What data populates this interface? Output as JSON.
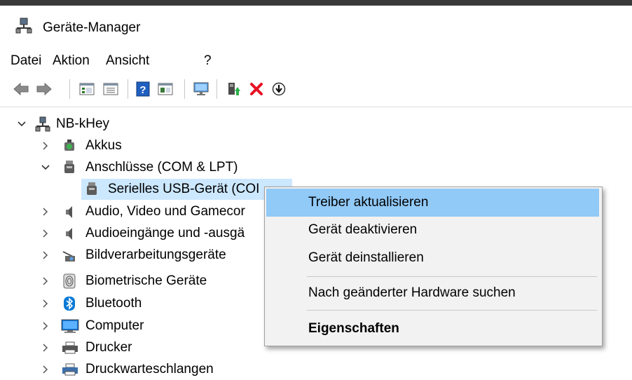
{
  "window": {
    "title": "Geräte-Manager"
  },
  "menu": [
    "Datei",
    "Aktion",
    "Ansicht",
    "?"
  ],
  "toolbar": [
    "back-icon",
    "forward-icon",
    "tree-view-icon",
    "properties-icon",
    "help-icon",
    "action-view-icon",
    "monitor-icon",
    "update-driver-icon",
    "uninstall-icon",
    "enable-icon"
  ],
  "tree": {
    "root": "NB-kHey",
    "items": [
      {
        "label": "Akkus",
        "expanded": false,
        "icon": "battery-icon"
      },
      {
        "label": "Anschlüsse (COM & LPT)",
        "expanded": true,
        "icon": "port-icon"
      },
      {
        "label": "Serielles USB-Gerät (COI",
        "child": true,
        "selected": true,
        "icon": "port-icon"
      },
      {
        "label": "Audio, Video und Gamecor",
        "expanded": false,
        "icon": "speaker-icon"
      },
      {
        "label": "Audioeingänge und -ausgä",
        "expanded": false,
        "icon": "speaker-icon"
      },
      {
        "label": "Bildverarbeitungsgeräte",
        "expanded": false,
        "icon": "camera-icon"
      },
      {
        "label": "Biometrische Geräte",
        "expanded": false,
        "icon": "fingerprint-icon"
      },
      {
        "label": "Bluetooth",
        "expanded": false,
        "icon": "bluetooth-icon"
      },
      {
        "label": "Computer",
        "expanded": false,
        "icon": "computer-icon"
      },
      {
        "label": "Drucker",
        "expanded": false,
        "icon": "printer-icon"
      },
      {
        "label": "Druckwarteschlangen",
        "expanded": false,
        "icon": "printer-icon"
      }
    ]
  },
  "context_menu": {
    "items": [
      "Treiber aktualisieren",
      "Gerät deaktivieren",
      "Gerät deinstallieren",
      "Nach geänderter Hardware suchen",
      "Eigenschaften"
    ]
  },
  "colors": {
    "selection": "#cce8ff",
    "menu_highlight": "#91c9f7",
    "menu_bg": "#f2f2f2",
    "delete_red": "#e81123",
    "bluetooth": "#0078d7"
  }
}
